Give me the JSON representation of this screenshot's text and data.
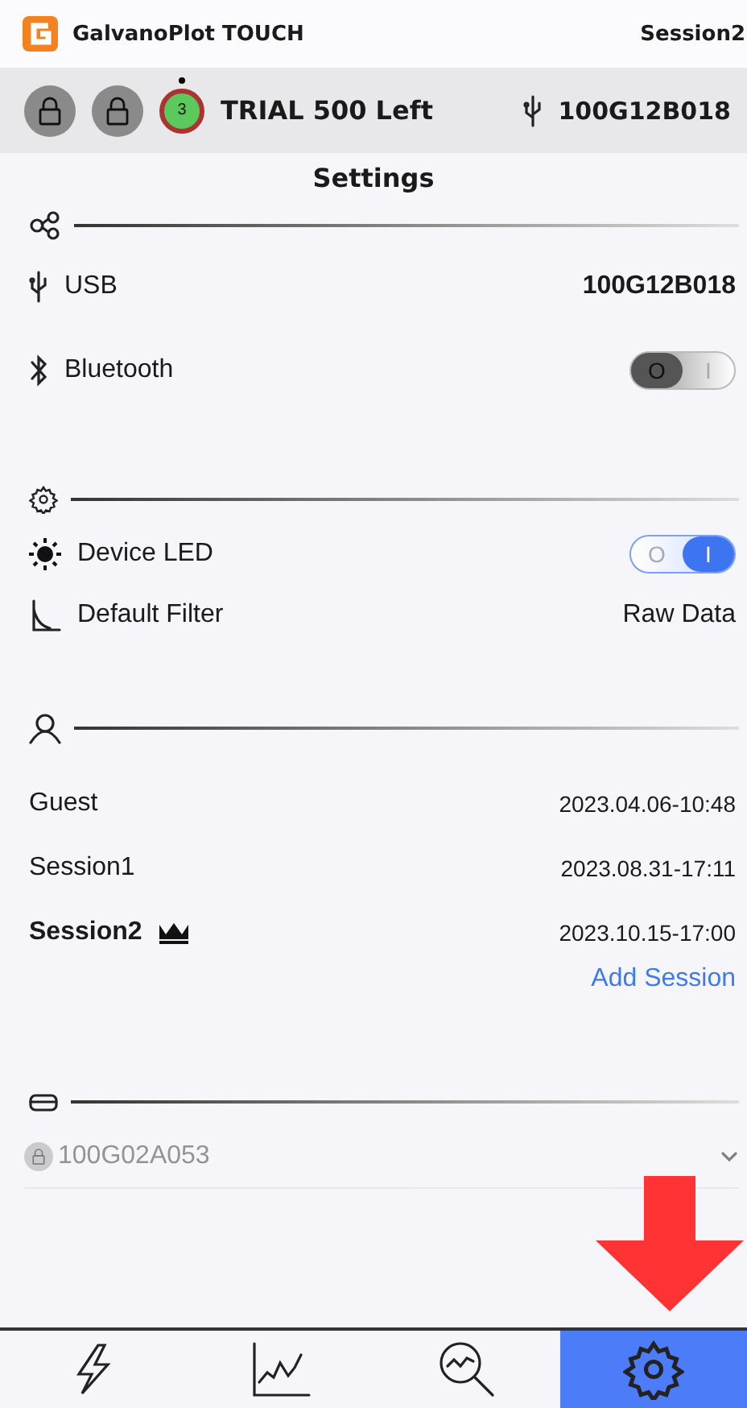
{
  "header": {
    "app_title": "GalvanoPlot TOUCH",
    "session": "Session2"
  },
  "status_bar": {
    "counter": "3",
    "trial": "TRIAL 500 Left",
    "usb_device": "100G12B018"
  },
  "page_title": "Settings",
  "connection": {
    "usb": {
      "label": "USB",
      "value": "100G12B018"
    },
    "bluetooth": {
      "label": "Bluetooth",
      "on": false,
      "off_mark": "O",
      "on_mark": "I"
    }
  },
  "device_settings": {
    "led": {
      "label": "Device LED",
      "on": true,
      "off_mark": "O",
      "on_mark": "I"
    },
    "filter": {
      "label": "Default Filter",
      "value": "Raw Data"
    }
  },
  "sessions": [
    {
      "name": "Guest",
      "date": "2023.04.06-10:48",
      "selected": false
    },
    {
      "name": "Session1",
      "date": "2023.08.31-17:11",
      "selected": false
    },
    {
      "name": "Session2",
      "date": "2023.10.15-17:00",
      "selected": true
    }
  ],
  "add_session": "Add Session",
  "device_select": {
    "serial": "100G02A053",
    "disabled": true
  },
  "nav_tabs": [
    {
      "selected": false
    },
    {
      "selected": false
    },
    {
      "selected": false
    },
    {
      "selected": true
    }
  ]
}
